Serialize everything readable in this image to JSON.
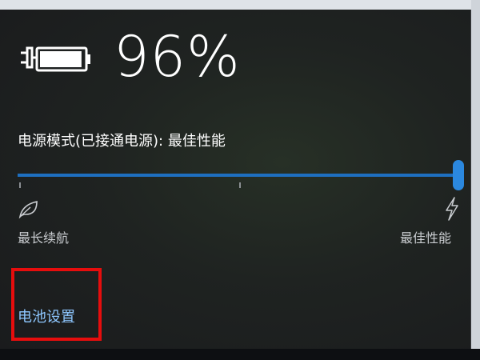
{
  "battery": {
    "percent_text": "96%",
    "level": 0.96,
    "plugged_in": true,
    "icon": "battery-charging-icon"
  },
  "power_mode": {
    "label": "电源模式(已接通电源): 最佳性能",
    "slider_value": 1.0,
    "min_label": "最长续航",
    "max_label": "最佳性能",
    "min_icon": "leaf-icon",
    "max_icon": "bolt-icon",
    "accent_color": "#2b88df"
  },
  "links": {
    "battery_settings": "电池设置"
  },
  "annotation": {
    "highlight_color": "#e60d0d"
  }
}
